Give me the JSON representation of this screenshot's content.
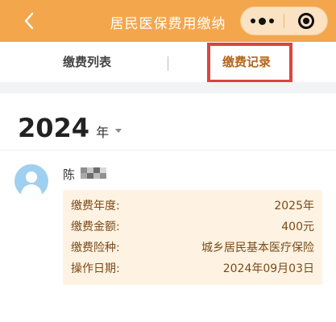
{
  "header": {
    "title": "居民医保费用缴纳",
    "back_glyph": "‹"
  },
  "tabs": [
    {
      "label": "缴费列表"
    },
    {
      "label": "缴费记录"
    }
  ],
  "year_selector": {
    "year": "2024",
    "unit": "年"
  },
  "record": {
    "name": "陈",
    "rows": [
      {
        "label": "缴费年度:",
        "value": "2025年"
      },
      {
        "label": "缴费金额:",
        "value": "400元"
      },
      {
        "label": "缴费险种:",
        "value": "城乡居民基本医疗保险"
      },
      {
        "label": "操作日期:",
        "value": "2024年09月03日"
      }
    ]
  },
  "colors": {
    "header_bg": "#f3a64c",
    "active_tab": "#b5651d",
    "highlight_border": "#d9463e",
    "card_bg": "#fef3e2"
  },
  "icons": [
    "back-icon",
    "more-icon",
    "close-icon",
    "caret-down-icon",
    "avatar-icon"
  ]
}
